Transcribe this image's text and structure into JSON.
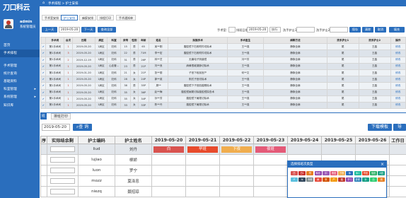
{
  "app": {
    "logo_text": "刀口科云",
    "user_name": "admin",
    "user_role": "系统管理员"
  },
  "header": {
    "home_icon": "home-icon",
    "breadcrumb": "手术排程  >  护士安排"
  },
  "sidebar": {
    "items": [
      {
        "label": "首页",
        "arrow": ""
      },
      {
        "label": "手术排程",
        "arrow": ""
      },
      {
        "label": "手术管理",
        "arrow": ""
      },
      {
        "label": "统计查询",
        "arrow": ""
      },
      {
        "label": "基础资料",
        "arrow": ""
      },
      {
        "label": "科室管理",
        "arrow": "▸"
      },
      {
        "label": "系统管理",
        "arrow": "▸"
      },
      {
        "label": "知识库",
        "arrow": ""
      }
    ]
  },
  "tabs": [
    "手术室安排",
    "护士安排",
    "麻醉安排",
    "排程打印",
    "手术通知单"
  ],
  "toolbar": {
    "prev": "上一天",
    "date": "2019-05-20",
    "next": "下一天",
    "query": "查询全部",
    "room_label": "手术室:",
    "room_value": "",
    "schedule_date_label": "排班日期:",
    "schedule_date_value": "2019-05-20",
    "status_value": "执行",
    "nurse_a_label": "洗手护士1:",
    "nurse_a_value": "",
    "nurse_b_label": "洗手护士2:",
    "nurse_b_value": "",
    "save": "保存",
    "clear": "清除",
    "cancel": "取消",
    "fill_all": "填充"
  },
  "upper_table": {
    "headers": [
      "",
      "手术间",
      "台次",
      "日期",
      "病区",
      "科室",
      "床号",
      "性别",
      "年龄",
      "姓名",
      "拟施手术",
      "手术医生",
      "麻醉方法",
      "洗手护士1",
      "洗手护士2",
      "操作"
    ],
    "rows": [
      [
        "✔",
        "第1手术间",
        "1",
        "2019-05-20",
        "1病区",
        "妇科",
        "15",
        "男",
        "65",
        "吴**刚",
        "腹腔镜下右侧附件切除术",
        "王**强",
        "静脉全麻",
        "尾",
        "王晶",
        "修改"
      ],
      [
        "✔",
        "第1手术间",
        "3",
        "2019-05-20",
        "1病区",
        "妇科",
        "22",
        "男",
        "71M",
        "李**宏",
        "腹腔镜下右侧附件切除术",
        "王**强",
        "静脉全麻",
        "尾",
        "王晶",
        "修改"
      ],
      [
        "✔",
        "第1手术间",
        "2",
        "2019-12-19",
        "1病区",
        "妇科",
        "31",
        "男",
        "26P",
        "林**芝",
        "无痛电子阴道镜",
        "冯**芳",
        "静脉全麻",
        "尾",
        "王晶",
        "修改"
      ],
      [
        "✔",
        "第1手术间",
        "1",
        "2019-05-20",
        "1病区",
        "心血管...",
        "23",
        "男",
        "21P",
        "刘**良",
        "麻黄根敦凝脉切除术",
        "王**强",
        "静脉全麻",
        "尾",
        "王晶",
        "修改"
      ],
      [
        "✔",
        "第1手术间",
        "1",
        "2019-01-20",
        "1病区",
        "妇科",
        "21",
        "女",
        "21P",
        "张**丽",
        "子宫下段剖宫产",
        "何**文",
        "静脉全麻",
        "尾",
        "王晶",
        "修改"
      ],
      [
        "✔",
        "第1手术间",
        "1",
        "2019-05-20",
        "1病区",
        "妇科",
        "28",
        "女",
        "24P",
        "郭**英",
        "阴式子宫切除术",
        "王**强",
        "静脉全麻",
        "尾",
        "王晶",
        "修改"
      ],
      [
        "✔",
        "第1手术间",
        "1",
        "2019-05-20",
        "1病区",
        "妇科",
        "38",
        "男",
        "35P",
        "周**",
        "腹腔镜下子宫肌瘤剔除术",
        "王**强",
        "静脉全麻",
        "尾",
        "王晶",
        "修改"
      ],
      [
        "✔",
        "第1手术间",
        "1",
        "2019-05-20",
        "1病区",
        "妇科",
        "35",
        "女",
        "36P",
        "赵**梅",
        "腹腔镜阑尾切除腹腔镜探查术",
        "王**强",
        "静脉全麻",
        "尾",
        "王晶",
        "修改"
      ],
      [
        "✔",
        "第1手术间",
        "1",
        "2019-05-20",
        "1病区",
        "妇科",
        "35",
        "女",
        "34P",
        "孙**芳",
        "腹腔镜下阑尾切除术",
        "王**强",
        "静脉全麻",
        "尾",
        "王晶",
        "修改"
      ],
      [
        "✔",
        "第1手术间",
        "1",
        "2019-05-20",
        "1病区",
        "妇科",
        "33",
        "女",
        "33P",
        "陈**丹",
        "腹腔镜下阑尾切除术",
        "王**强",
        "静脉全麻",
        "尾",
        "王晶",
        "修改"
      ]
    ]
  },
  "lower": {
    "tab_a": "班",
    "tab_b": "排班打印",
    "date": "2019-05-20",
    "query": "查 询",
    "download": "下载模板",
    "export": "导",
    "headers": [
      "序",
      "实际结余剩",
      "护士编码",
      "护士姓名",
      "2019-05-20",
      "2019-05-21",
      "2019-05-22",
      "2019-05-23",
      "2019-05-24",
      "2019-05-25",
      "2019-05-26",
      "工作日"
    ],
    "rows": [
      {
        "code": "liud",
        "name": "刘丹"
      },
      {
        "code": "lujiao",
        "name": "柳娇"
      },
      {
        "code": "luon",
        "name": "罗宁"
      },
      {
        "code": "mozz",
        "name": "莫泽忠"
      },
      {
        "code": "niezq",
        "name": "聂招琼"
      }
    ],
    "first_row_shifts": [
      {
        "label": "白",
        "color": "#d9534f"
      },
      {
        "label": "早班",
        "color": "#e84b2c"
      },
      {
        "label": "下夜",
        "color": "#f0ad4e"
      },
      {
        "label": "夜班",
        "color": "#e45a78"
      }
    ]
  },
  "popup": {
    "title": "选择排班次类型",
    "close": "×",
    "chips": [
      {
        "label": "白",
        "color": "#d9534f"
      },
      {
        "label": "白1",
        "color": "#c9302c"
      },
      {
        "label": "早",
        "color": "#e67e22"
      },
      {
        "label": "晚班",
        "color": "#8e44ad"
      },
      {
        "label": "中",
        "color": "#9b59b6"
      },
      {
        "label": "夜班",
        "color": "#e45a78"
      },
      {
        "label": "下夜",
        "color": "#f0ad4e"
      },
      {
        "label": "休",
        "color": "#2a6ebd"
      },
      {
        "label": "休1",
        "color": "#1abc9c"
      },
      {
        "label": "早班",
        "color": "#e84b2c"
      },
      {
        "label": "值班",
        "color": "#27ae60"
      },
      {
        "label": "A班",
        "color": "#16a085"
      },
      {
        "label": "P",
        "color": "#5bc0de"
      },
      {
        "label": "N",
        "color": "#34495e"
      },
      {
        "label": "年假",
        "color": "#7f8c8d"
      },
      {
        "label": "病",
        "color": "#e74c3c"
      },
      {
        "label": "事",
        "color": "#d35400"
      },
      {
        "label": "产",
        "color": "#f39c12"
      },
      {
        "label": "婚",
        "color": "#c0392b"
      },
      {
        "label": "学习",
        "color": "#8e44ad"
      },
      {
        "label": "进修",
        "color": "#2980b9"
      },
      {
        "label": "补",
        "color": "#16a085"
      },
      {
        "label": "加",
        "color": "#2ecc71"
      },
      {
        "label": "调",
        "color": "#e67e22"
      }
    ]
  }
}
